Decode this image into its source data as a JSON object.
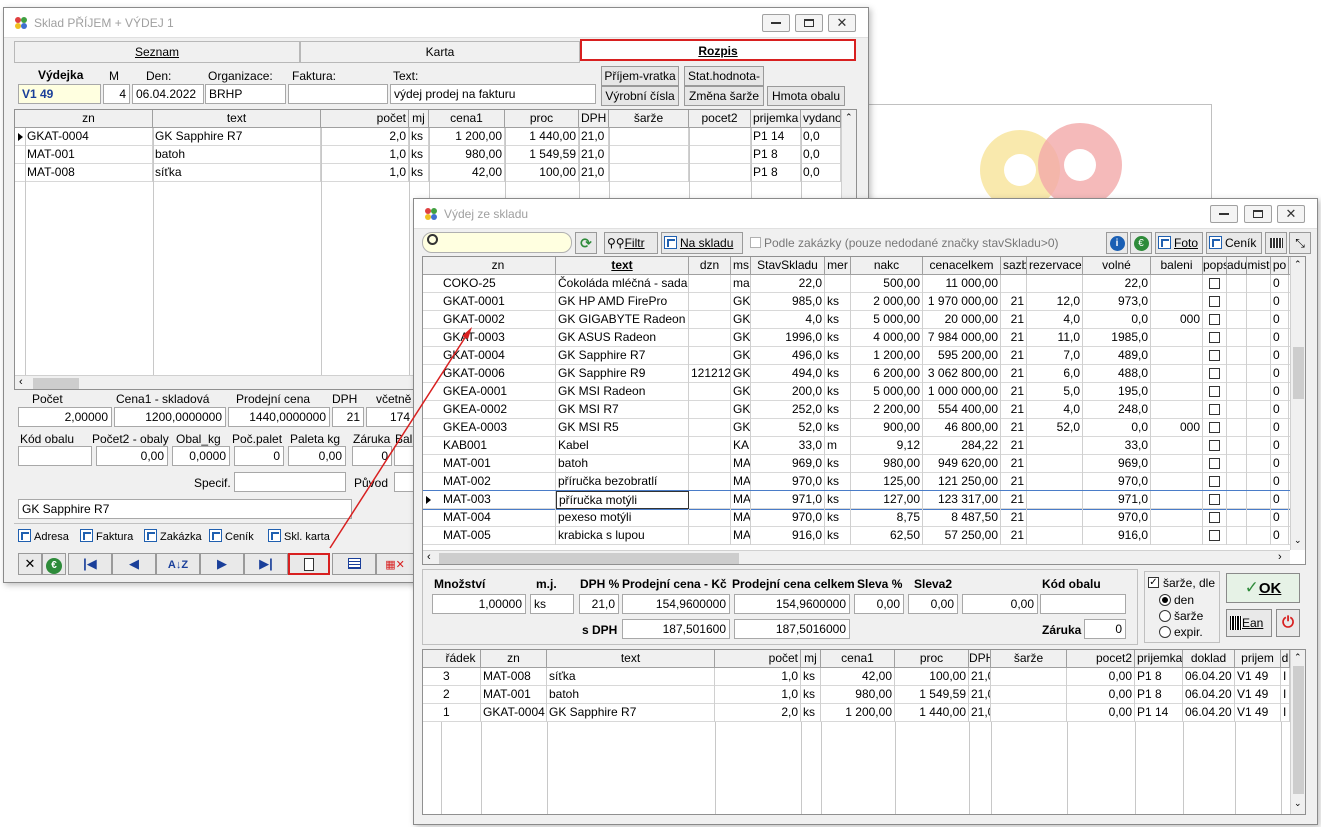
{
  "main_window": {
    "title": "Sklad PŘÍJEM + VÝDEJ 1",
    "tabs": [
      "Seznam",
      "Karta",
      "Rozpis"
    ],
    "header": {
      "labels": {
        "vydejka": "Výdejka",
        "m": "M",
        "den": "Den:",
        "organizace": "Organizace:",
        "faktura": "Faktura:",
        "text": "Text:"
      },
      "values": {
        "doklad": "V1  49",
        "m": "4",
        "den": "06.04.2022",
        "organizace": "BRHP",
        "faktura": "",
        "text": "výdej prodej na fakturu"
      }
    },
    "buttons": {
      "prijem_vratka": "Příjem-vratka",
      "vyrobni_cisla": "Výrobní čísla",
      "stat_hodnota": "Stat.hodnota-",
      "zmena_sarze": "Změna šarže",
      "hmota_obalu": "Hmota obalu"
    },
    "grid": {
      "columns": [
        "zn",
        "text",
        "počet",
        "mj",
        "cena1",
        "proc",
        "DPH",
        "šarže",
        "pocet2",
        "prijemka",
        "vydano"
      ],
      "rows": [
        [
          "GKAT-0004",
          "GK Sapphire R7",
          "2,0",
          "ks",
          "1 200,00",
          "1 440,00",
          "21,0",
          "",
          "",
          "P1  14",
          "0,0"
        ],
        [
          "MAT-001",
          "batoh",
          "1,0",
          "ks",
          "980,00",
          "1 549,59",
          "21,0",
          "",
          "",
          "P1   8",
          "0,0"
        ],
        [
          "MAT-008",
          "síťka",
          "1,0",
          "ks",
          "42,00",
          "100,00",
          "21,0",
          "",
          "",
          "P1   8",
          "0,0"
        ]
      ]
    },
    "detail": {
      "labels": {
        "pocet": "Počet",
        "cena1": "Cena1 - skladová",
        "prodejni": "Prodejní cena",
        "dph": "DPH",
        "vcetne": "včetně",
        "kod_obalu": "Kód obalu",
        "pocet2": "Počet2 - obaly",
        "obal_kg": "Obal_kg",
        "poc_palet": "Poč.palet",
        "paleta_kg": "Paleta kg",
        "zaruka": "Záruka",
        "bal": "Bal",
        "specif": "Specif.",
        "puvod": "Původ"
      },
      "values": {
        "pocet": "2,00000",
        "cena1": "1200,0000000",
        "prodejni": "1440,0000000",
        "dph": "21",
        "vcetne": "174",
        "pocet2": "0,00",
        "obal_kg": "0,0000",
        "poc_palet": "0",
        "paleta_kg": "0,00",
        "zaruka": "0",
        "nazev": "GK Sapphire R7"
      }
    },
    "links": [
      "Adresa",
      "Faktura",
      "Zakázka",
      "Ceník",
      "Skl. karta"
    ]
  },
  "issue_window": {
    "title": "Výdej ze skladu",
    "search_value": "",
    "buttons": {
      "filtr": "Filtr",
      "na_skladu": "Na skladu",
      "foto": "Foto",
      "cenik": "Ceník"
    },
    "podle_zakazky": "Podle zakázky  (pouze nedodané značky stavSkladu>0)",
    "grid": {
      "columns": [
        "zn",
        "text",
        "dzn",
        "ms",
        "StavSkladu",
        "mer",
        "nakc",
        "cenacelkem",
        "sazb",
        "rezervace",
        "volné",
        "baleni",
        "pops",
        "adu",
        "mist",
        "po"
      ],
      "rows": [
        [
          "COKO-25",
          "Čokoláda mléčná - sada",
          "",
          "ma",
          "22,0",
          "",
          "500,00",
          "11 000,00",
          "",
          "",
          "22,0",
          "",
          "",
          "",
          "",
          "0"
        ],
        [
          "GKAT-0001",
          "GK HP AMD FirePro",
          "",
          "GK",
          "985,0",
          "ks",
          "2 000,00",
          "1 970 000,00",
          "21",
          "12,0",
          "973,0",
          "",
          "",
          "",
          "",
          "0"
        ],
        [
          "GKAT-0002",
          "GK  GIGABYTE Radeon",
          "",
          "GK",
          "4,0",
          "ks",
          "5 000,00",
          "20 000,00",
          "21",
          "4,0",
          "0,0",
          "000",
          "",
          "",
          "",
          "0"
        ],
        [
          "GKAT-0003",
          "GK ASUS Radeon",
          "",
          "GK",
          "1996,0",
          "ks",
          "4 000,00",
          "7 984 000,00",
          "21",
          "11,0",
          "1985,0",
          "",
          "",
          "",
          "",
          "0"
        ],
        [
          "GKAT-0004",
          "GK Sapphire R7",
          "",
          "GK",
          "496,0",
          "ks",
          "1 200,00",
          "595 200,00",
          "21",
          "7,0",
          "489,0",
          "",
          "",
          "",
          "",
          "0"
        ],
        [
          "GKAT-0006",
          "GK Sapphire R9",
          "121212",
          "GK",
          "494,0",
          "ks",
          "6 200,00",
          "3 062 800,00",
          "21",
          "6,0",
          "488,0",
          "",
          "",
          "",
          "",
          "0"
        ],
        [
          "GKEA-0001",
          "GK MSI  Radeon",
          "",
          "GK",
          "200,0",
          "ks",
          "5 000,00",
          "1 000 000,00",
          "21",
          "5,0",
          "195,0",
          "",
          "",
          "",
          "",
          "0"
        ],
        [
          "GKEA-0002",
          "GK MSI R7",
          "",
          "GK",
          "252,0",
          "ks",
          "2 200,00",
          "554 400,00",
          "21",
          "4,0",
          "248,0",
          "",
          "",
          "",
          "",
          "0"
        ],
        [
          "GKEA-0003",
          "GK MSI R5",
          "",
          "GK",
          "52,0",
          "ks",
          "900,00",
          "46 800,00",
          "21",
          "52,0",
          "0,0",
          "000",
          "",
          "",
          "",
          "0"
        ],
        [
          "KAB001",
          "Kabel",
          "",
          "KA",
          "33,0",
          "m",
          "9,12",
          "284,22",
          "21",
          "",
          "33,0",
          "",
          "",
          "",
          "",
          "0"
        ],
        [
          "MAT-001",
          "batoh",
          "",
          "MA",
          "969,0",
          "ks",
          "980,00",
          "949 620,00",
          "21",
          "",
          "969,0",
          "",
          "",
          "",
          "",
          "0"
        ],
        [
          "MAT-002",
          "příručka bezobratlí",
          "",
          "MA",
          "970,0",
          "ks",
          "125,00",
          "121 250,00",
          "21",
          "",
          "970,0",
          "",
          "",
          "",
          "",
          "0"
        ],
        [
          "MAT-003",
          "příručka motýli",
          "",
          "MA",
          "971,0",
          "ks",
          "127,00",
          "123 317,00",
          "21",
          "",
          "971,0",
          "",
          "",
          "",
          "",
          "0"
        ],
        [
          "MAT-004",
          "pexeso motýli",
          "",
          "MA",
          "970,0",
          "ks",
          "8,75",
          "8 487,50",
          "21",
          "",
          "970,0",
          "",
          "",
          "",
          "",
          "0"
        ],
        [
          "MAT-005",
          "krabicka s lupou",
          "",
          "MA",
          "916,0",
          "ks",
          "62,50",
          "57 250,00",
          "21",
          "",
          "916,0",
          "",
          "",
          "",
          "",
          "0"
        ]
      ]
    },
    "entry": {
      "labels": {
        "mnozstvi": "Množství",
        "mj": "m.j.",
        "dph": "DPH %",
        "prodejni_cena": "Prodejní cena - Kč",
        "prodejni_celkem": "Prodejní cena celkem",
        "sleva": "Sleva %",
        "sleva2": "Sleva2",
        "kod_obalu": "Kód obalu",
        "s_dph": "s DPH",
        "zaruka": "Záruka"
      },
      "values": {
        "mnozstvi": "1,00000",
        "mj": "ks",
        "dph": "21,0",
        "prodejni_cena": "154,9600000",
        "prodejni_celkem": "154,9600000",
        "sleva": "0,00",
        "sleva2": "0,00",
        "sleva3": "0,00",
        "kod_obalu": "",
        "s_dph_cena": "187,501600",
        "s_dph_celkem": "187,5016000",
        "zaruka": "0"
      }
    },
    "options": {
      "sarze_dle": "šarže, dle",
      "den": "den",
      "sarze": "šarže",
      "expir": "expir."
    },
    "ok_label": "OK",
    "ean_label": "Ean",
    "lower_grid": {
      "columns": [
        "řádek",
        "zn",
        "text",
        "počet",
        "mj",
        "cena1",
        "proc",
        "DPH",
        "šarže",
        "pocet2",
        "prijemka",
        "doklad",
        "prijem",
        "d"
      ],
      "rows": [
        [
          "3",
          "MAT-008",
          "síťka",
          "1,0",
          "ks",
          "42,00",
          "100,00",
          "21,0",
          "",
          "0,00",
          "P1   8",
          "06.04.20",
          "V1  49",
          "I"
        ],
        [
          "2",
          "MAT-001",
          "batoh",
          "1,0",
          "ks",
          "980,00",
          "1 549,59",
          "21,0",
          "",
          "0,00",
          "P1   8",
          "06.04.20",
          "V1  49",
          "I"
        ],
        [
          "1",
          "GKAT-0004",
          "GK Sapphire R7",
          "2,0",
          "ks",
          "1 200,00",
          "1 440,00",
          "21,0",
          "",
          "0,00",
          "P1  14",
          "06.04.20",
          "V1  49",
          "I"
        ]
      ]
    }
  },
  "colors": {
    "accent_red": "#d82020",
    "title_gray": "#a0a0a0",
    "highlight_yellow": "#ffffe0",
    "link_blue": "#2060b0"
  }
}
